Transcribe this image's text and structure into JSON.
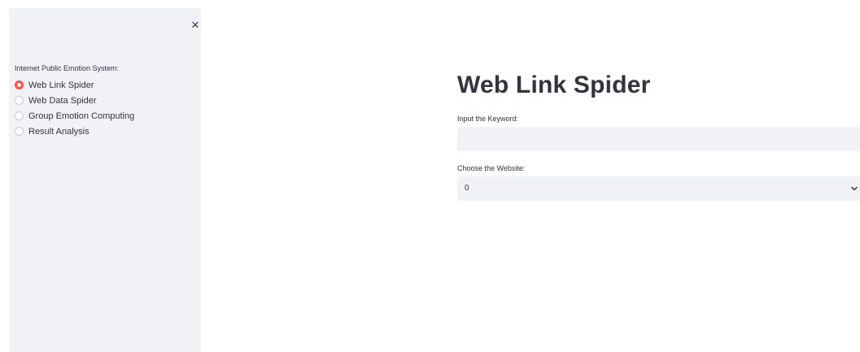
{
  "sidebar": {
    "close_symbol": "×",
    "radio_group_label": "Internet Public Emotion System:",
    "options": [
      {
        "label": "Web Link Spider",
        "selected": true
      },
      {
        "label": "Web Data Spider",
        "selected": false
      },
      {
        "label": "Group Emotion Computing",
        "selected": false
      },
      {
        "label": "Result Analysis",
        "selected": false
      }
    ]
  },
  "main": {
    "title": "Web Link Spider",
    "keyword_label": "Input the Keyword:",
    "keyword_value": "",
    "website_label": "Choose the Website:",
    "website_value": "0"
  },
  "icons": {
    "close": "close-icon",
    "dropdown": "chevron-down-icon",
    "radio": "radio-icon"
  },
  "colors": {
    "sidebar_bg": "#f0f2f6",
    "accent": "#ff4b4b",
    "text": "#31333f",
    "input_bg": "#f0f2f6"
  }
}
